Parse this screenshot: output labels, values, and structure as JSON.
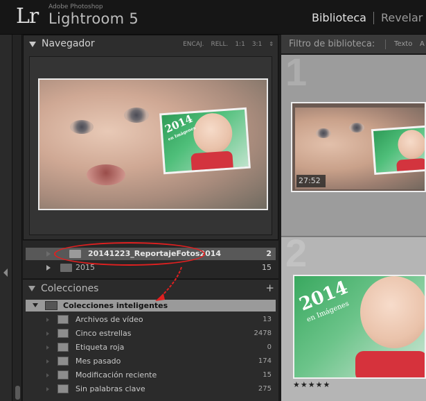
{
  "header": {
    "logo": "Lr",
    "brand_sub": "Adobe Photoshop",
    "brand_main": "Lightroom 5",
    "modules": [
      {
        "label": "Biblioteca",
        "active": true
      },
      {
        "label": "Revelar",
        "active": false
      }
    ]
  },
  "navigator": {
    "title": "Navegador",
    "zoom_options": [
      "ENCAJ.",
      "RELL.",
      "1:1",
      "3:1"
    ]
  },
  "filter_bar": {
    "label": "Filtro de biblioteca:",
    "options": [
      "Texto",
      "A"
    ]
  },
  "grid": {
    "cell_numbers": [
      "1",
      "2"
    ],
    "thumb1_time": "27:52",
    "thumb2_rating": "★★★★★"
  },
  "photo_text": {
    "year": "2014",
    "subtitle": "en Imágenes"
  },
  "folders": [
    {
      "name": "20141223_ReportajeFotos2014",
      "count": "2",
      "selected": true
    },
    {
      "name": "2015",
      "count": "15",
      "selected": false
    }
  ],
  "collections": {
    "title": "Colecciones",
    "add_icon": "+",
    "smart_set": "Colecciones inteligentes",
    "items": [
      {
        "label": "Archivos de vídeo",
        "count": "13"
      },
      {
        "label": "Cinco estrellas",
        "count": "2478"
      },
      {
        "label": "Etiqueta roja",
        "count": "0"
      },
      {
        "label": "Mes pasado",
        "count": "174"
      },
      {
        "label": "Modificación reciente",
        "count": "15"
      },
      {
        "label": "Sin palabras clave",
        "count": "275"
      }
    ]
  },
  "colors": {
    "annotation_red": "#e02020",
    "accent_green": "#3daa62",
    "selected_row": "#585858"
  }
}
